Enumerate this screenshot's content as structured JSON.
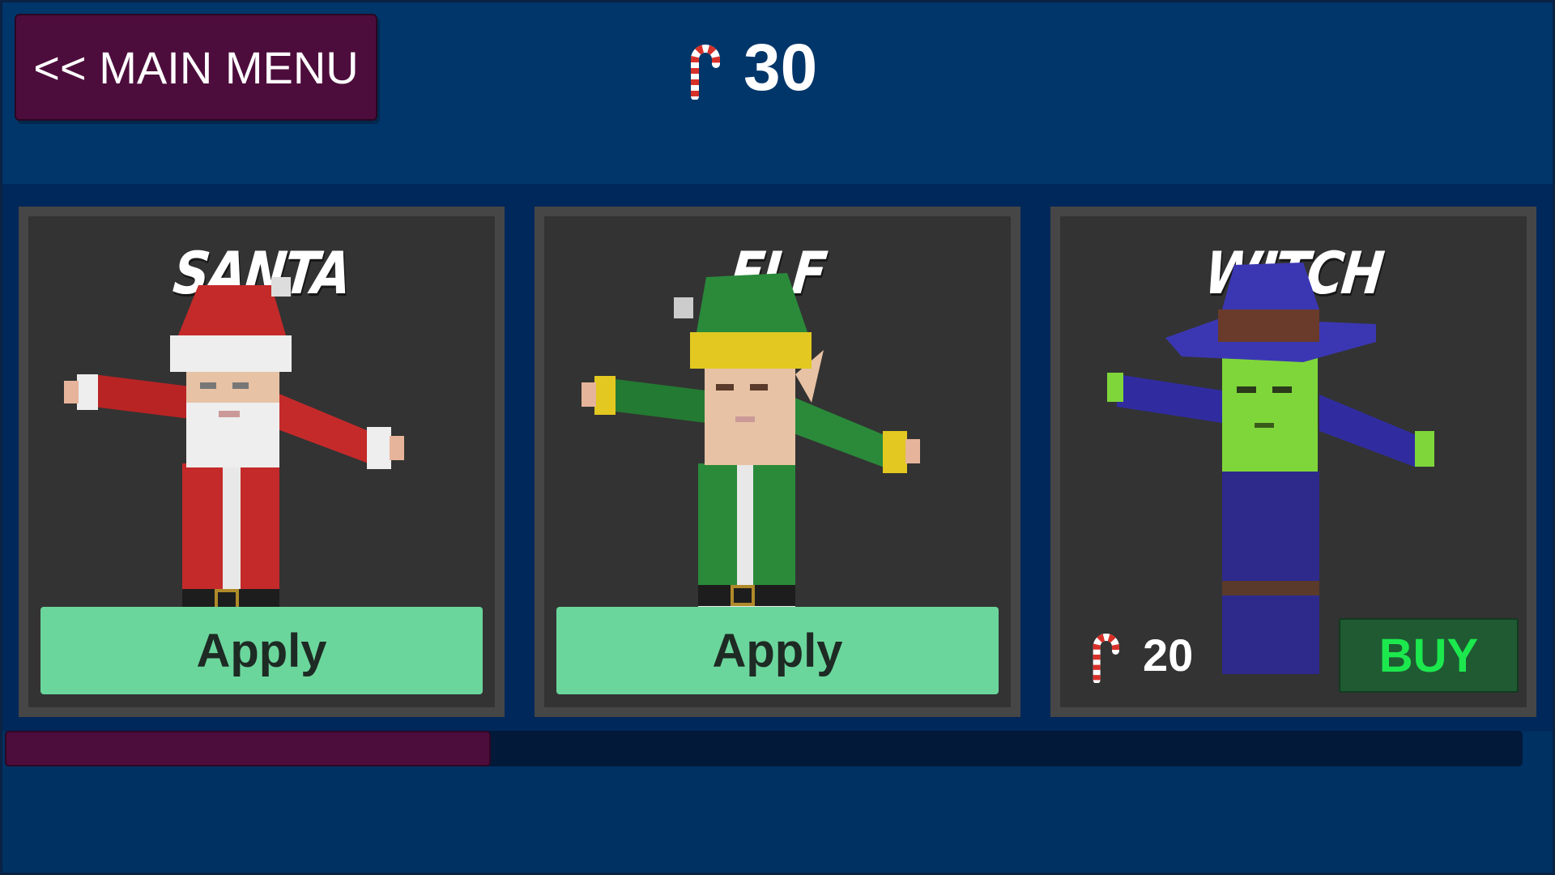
{
  "nav": {
    "main_menu_label": "<< MAIN MENU"
  },
  "currency": {
    "icon": "candy-cane-icon",
    "amount": "30"
  },
  "characters": [
    {
      "name": "SANTA",
      "action": "Apply"
    },
    {
      "name": "ELF",
      "action": "Apply"
    },
    {
      "name": "WITCH",
      "price": "20",
      "price_icon": "candy-cane-icon",
      "action": "BUY"
    }
  ],
  "scroll": {
    "position_fraction": 0.0,
    "visible_fraction": 0.32
  },
  "colors": {
    "background": "#003163",
    "menu_button": "#4d0d3c",
    "apply_button": "#6bd69c",
    "buy_button": "#1f5a32",
    "buy_text": "#1ce84e",
    "card": "#333333"
  }
}
